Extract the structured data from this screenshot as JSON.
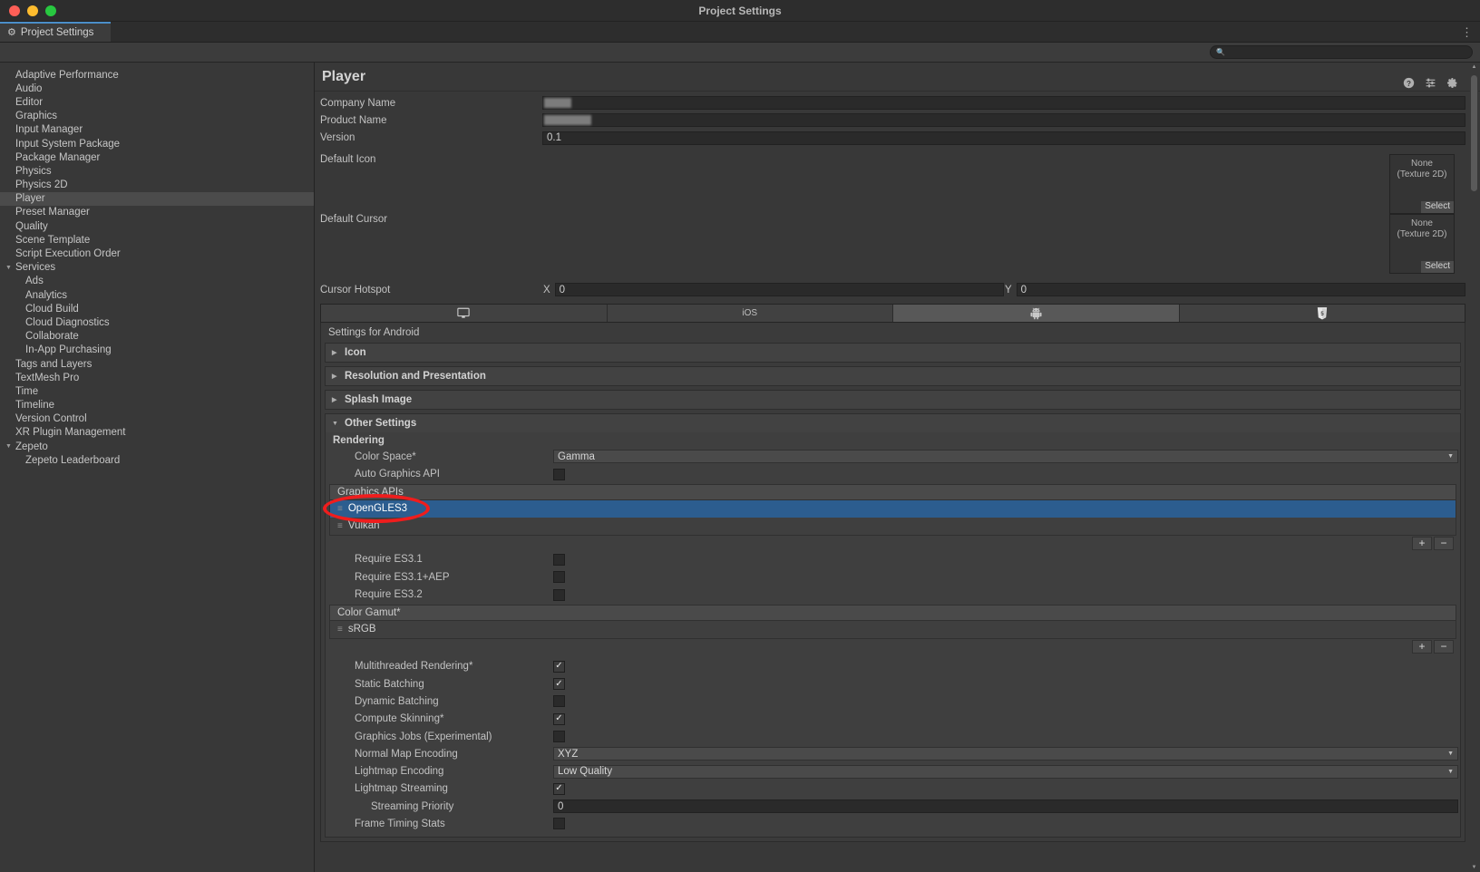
{
  "window": {
    "title": "Project Settings",
    "traffic_lights": [
      "close",
      "minimize",
      "zoom"
    ]
  },
  "tabstrip": {
    "tab_label": "Project Settings",
    "tab_icon": "gear-icon",
    "overflow_icon": "kebab-menu-icon"
  },
  "search": {
    "value": "",
    "placeholder": "",
    "icon": "search-icon"
  },
  "sidebar": {
    "items": [
      {
        "label": "Adaptive Performance",
        "level": 0,
        "expandable": false,
        "selected": false
      },
      {
        "label": "Audio",
        "level": 0,
        "expandable": false,
        "selected": false
      },
      {
        "label": "Editor",
        "level": 0,
        "expandable": false,
        "selected": false
      },
      {
        "label": "Graphics",
        "level": 0,
        "expandable": false,
        "selected": false
      },
      {
        "label": "Input Manager",
        "level": 0,
        "expandable": false,
        "selected": false
      },
      {
        "label": "Input System Package",
        "level": 0,
        "expandable": false,
        "selected": false
      },
      {
        "label": "Package Manager",
        "level": 0,
        "expandable": false,
        "selected": false
      },
      {
        "label": "Physics",
        "level": 0,
        "expandable": false,
        "selected": false
      },
      {
        "label": "Physics 2D",
        "level": 0,
        "expandable": false,
        "selected": false
      },
      {
        "label": "Player",
        "level": 0,
        "expandable": false,
        "selected": true
      },
      {
        "label": "Preset Manager",
        "level": 0,
        "expandable": false,
        "selected": false
      },
      {
        "label": "Quality",
        "level": 0,
        "expandable": false,
        "selected": false
      },
      {
        "label": "Scene Template",
        "level": 0,
        "expandable": false,
        "selected": false
      },
      {
        "label": "Script Execution Order",
        "level": 0,
        "expandable": false,
        "selected": false
      },
      {
        "label": "Services",
        "level": 0,
        "expandable": true,
        "expanded": true,
        "selected": false
      },
      {
        "label": "Ads",
        "level": 1,
        "expandable": false,
        "selected": false
      },
      {
        "label": "Analytics",
        "level": 1,
        "expandable": false,
        "selected": false
      },
      {
        "label": "Cloud Build",
        "level": 1,
        "expandable": false,
        "selected": false
      },
      {
        "label": "Cloud Diagnostics",
        "level": 1,
        "expandable": false,
        "selected": false
      },
      {
        "label": "Collaborate",
        "level": 1,
        "expandable": false,
        "selected": false
      },
      {
        "label": "In-App Purchasing",
        "level": 1,
        "expandable": false,
        "selected": false
      },
      {
        "label": "Tags and Layers",
        "level": 0,
        "expandable": false,
        "selected": false
      },
      {
        "label": "TextMesh Pro",
        "level": 0,
        "expandable": false,
        "selected": false
      },
      {
        "label": "Time",
        "level": 0,
        "expandable": false,
        "selected": false
      },
      {
        "label": "Timeline",
        "level": 0,
        "expandable": false,
        "selected": false
      },
      {
        "label": "Version Control",
        "level": 0,
        "expandable": false,
        "selected": false
      },
      {
        "label": "XR Plugin Management",
        "level": 0,
        "expandable": false,
        "selected": false
      },
      {
        "label": "Zepeto",
        "level": 0,
        "expandable": true,
        "expanded": true,
        "selected": false
      },
      {
        "label": "Zepeto Leaderboard",
        "level": 1,
        "expandable": false,
        "selected": false
      }
    ]
  },
  "main": {
    "page_title": "Player",
    "header_icons": [
      "help-icon",
      "preset-icon",
      "settings-gear-icon"
    ],
    "general": {
      "company_name": {
        "label": "Company Name",
        "value": "",
        "redacted": true,
        "redact_width": 30
      },
      "product_name": {
        "label": "Product Name",
        "value": "",
        "redacted": true,
        "redact_width": 52
      },
      "version": {
        "label": "Version",
        "value": "0.1"
      },
      "default_icon": {
        "label": "Default Icon",
        "value": "None",
        "type_line": "(Texture 2D)",
        "select_label": "Select"
      },
      "default_cursor": {
        "label": "Default Cursor",
        "value": "None",
        "type_line": "(Texture 2D)",
        "select_label": "Select"
      },
      "cursor_hotspot": {
        "label": "Cursor Hotspot",
        "x_label": "X",
        "x_value": "0",
        "y_label": "Y",
        "y_value": "0"
      }
    },
    "platform_tabs": [
      {
        "name": "standalone",
        "icon": "monitor-icon",
        "label": "",
        "active": false
      },
      {
        "name": "ios",
        "icon": "",
        "label": "iOS",
        "active": false
      },
      {
        "name": "android",
        "icon": "android-robot-icon",
        "label": "",
        "active": true
      },
      {
        "name": "webgl",
        "icon": "html5-icon",
        "label": "",
        "active": false
      }
    ],
    "settings_for": "Settings for Android",
    "foldouts": [
      {
        "label": "Icon",
        "expanded": false
      },
      {
        "label": "Resolution and Presentation",
        "expanded": false
      },
      {
        "label": "Splash Image",
        "expanded": false
      },
      {
        "label": "Other Settings",
        "expanded": true
      }
    ],
    "other_settings": {
      "rendering_title": "Rendering",
      "color_space": {
        "label": "Color Space*",
        "value": "Gamma"
      },
      "auto_graphics_api": {
        "label": "Auto Graphics API",
        "checked": false
      },
      "graphics_apis": {
        "header": "Graphics APIs",
        "items": [
          {
            "label": "OpenGLES3",
            "selected": true
          },
          {
            "label": "Vulkan",
            "selected": false
          }
        ],
        "add_label": "+",
        "remove_label": "−"
      },
      "require_es31": {
        "label": "Require ES3.1",
        "checked": false
      },
      "require_es31_aep": {
        "label": "Require ES3.1+AEP",
        "checked": false
      },
      "require_es32": {
        "label": "Require ES3.2",
        "checked": false
      },
      "color_gamut": {
        "header": "Color Gamut*",
        "items": [
          {
            "label": "sRGB",
            "selected": false
          }
        ],
        "add_label": "+",
        "remove_label": "−"
      },
      "multithreaded_rendering": {
        "label": "Multithreaded Rendering*",
        "checked": true
      },
      "static_batching": {
        "label": "Static Batching",
        "checked": true
      },
      "dynamic_batching": {
        "label": "Dynamic Batching",
        "checked": false
      },
      "compute_skinning": {
        "label": "Compute Skinning*",
        "checked": true
      },
      "graphics_jobs": {
        "label": "Graphics Jobs (Experimental)",
        "checked": false
      },
      "normal_map_encoding": {
        "label": "Normal Map Encoding",
        "value": "XYZ"
      },
      "lightmap_encoding": {
        "label": "Lightmap Encoding",
        "value": "Low Quality"
      },
      "lightmap_streaming": {
        "label": "Lightmap Streaming",
        "checked": true
      },
      "streaming_priority": {
        "label": "Streaming Priority",
        "value": "0"
      },
      "frame_timing_stats": {
        "label": "Frame Timing Stats",
        "checked": false
      }
    }
  },
  "annotation": {
    "type": "red-ellipse-highlight",
    "target": "OpenGLES3",
    "color": "#ef1d1d"
  },
  "colors": {
    "background": "#383838",
    "panel": "#3b3b3b",
    "selection_blue": "#2c5d8f",
    "sidebar_selected": "#4b4b4b",
    "tab_accent": "#4b8ec9",
    "annotation_red": "#ef1d1d"
  }
}
